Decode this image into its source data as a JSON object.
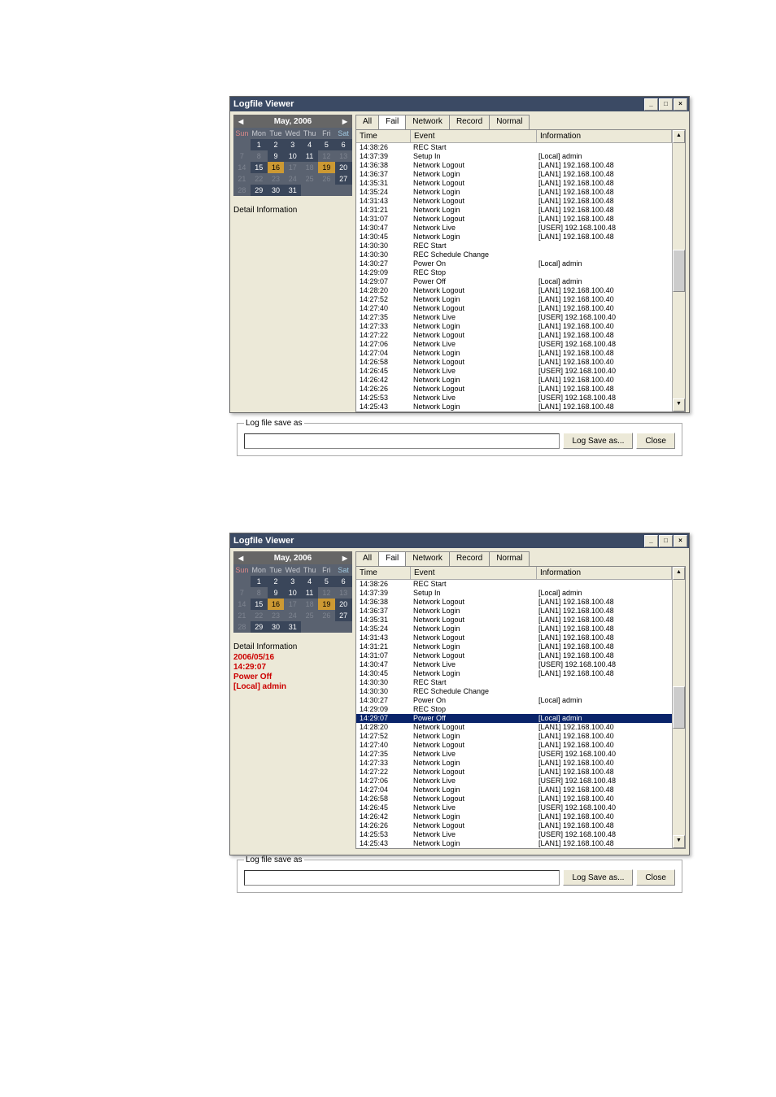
{
  "title": "Logfile Viewer",
  "month_label": "May, 2006",
  "dow": [
    "Sun",
    "Mon",
    "Tue",
    "Wed",
    "Thu",
    "Fri",
    "Sat"
  ],
  "calendar": [
    [
      {
        "v": "",
        "c": ""
      },
      {
        "v": "1",
        "c": "hi0"
      },
      {
        "v": "2",
        "c": "hi0"
      },
      {
        "v": "3",
        "c": "hi0"
      },
      {
        "v": "4",
        "c": "hi0"
      },
      {
        "v": "5",
        "c": "hi0"
      },
      {
        "v": "6",
        "c": "hi0"
      }
    ],
    [
      {
        "v": "7",
        "c": "dim"
      },
      {
        "v": "8",
        "c": "dim"
      },
      {
        "v": "9",
        "c": "hi0"
      },
      {
        "v": "10",
        "c": "hi0"
      },
      {
        "v": "11",
        "c": "hi0"
      },
      {
        "v": "12",
        "c": "dim"
      },
      {
        "v": "13",
        "c": "dim"
      }
    ],
    [
      {
        "v": "14",
        "c": "dim"
      },
      {
        "v": "15",
        "c": "hi0"
      },
      {
        "v": "16",
        "c": "hi1"
      },
      {
        "v": "17",
        "c": "dim"
      },
      {
        "v": "18",
        "c": "dim"
      },
      {
        "v": "19",
        "c": "hi1"
      },
      {
        "v": "20",
        "c": "hi0"
      }
    ],
    [
      {
        "v": "21",
        "c": "dim"
      },
      {
        "v": "22",
        "c": "dim"
      },
      {
        "v": "23",
        "c": "dim"
      },
      {
        "v": "24",
        "c": "dim"
      },
      {
        "v": "25",
        "c": "dim"
      },
      {
        "v": "26",
        "c": "dim"
      },
      {
        "v": "27",
        "c": "hi0"
      }
    ],
    [
      {
        "v": "28",
        "c": "dim"
      },
      {
        "v": "29",
        "c": "hi0"
      },
      {
        "v": "30",
        "c": "hi0"
      },
      {
        "v": "31",
        "c": "hi0"
      },
      {
        "v": "",
        "c": ""
      },
      {
        "v": "",
        "c": ""
      },
      {
        "v": "",
        "c": ""
      }
    ]
  ],
  "detail_label": "Detail Information",
  "detail2": [
    "2006/05/16",
    "14:29:07",
    "Power Off",
    "[Local] admin"
  ],
  "tabs": [
    "All",
    "Fail",
    "Network",
    "Record",
    "Normal"
  ],
  "active_tab": 1,
  "list_headers": {
    "time": "Time",
    "event": "Event",
    "info": "Information"
  },
  "logs": [
    {
      "t": "14:38:26",
      "e": "REC Start",
      "i": ""
    },
    {
      "t": "14:37:39",
      "e": "Setup In",
      "i": "[Local] admin"
    },
    {
      "t": "14:36:38",
      "e": "Network Logout",
      "i": "[LAN1] 192.168.100.48"
    },
    {
      "t": "14:36:37",
      "e": "Network Login",
      "i": "[LAN1] 192.168.100.48"
    },
    {
      "t": "14:35:31",
      "e": "Network Logout",
      "i": "[LAN1] 192.168.100.48"
    },
    {
      "t": "14:35:24",
      "e": "Network Login",
      "i": "[LAN1] 192.168.100.48"
    },
    {
      "t": "14:31:43",
      "e": "Network Logout",
      "i": "[LAN1] 192.168.100.48"
    },
    {
      "t": "14:31:21",
      "e": "Network Login",
      "i": "[LAN1] 192.168.100.48"
    },
    {
      "t": "14:31:07",
      "e": "Network Logout",
      "i": "[LAN1] 192.168.100.48"
    },
    {
      "t": "14:30:47",
      "e": "Network Live",
      "i": "[USER] 192.168.100.48"
    },
    {
      "t": "14:30:45",
      "e": "Network Login",
      "i": "[LAN1] 192.168.100.48"
    },
    {
      "t": "14:30:30",
      "e": "REC Start",
      "i": ""
    },
    {
      "t": "14:30:30",
      "e": "REC Schedule Change",
      "i": ""
    },
    {
      "t": "14:30:27",
      "e": "Power On",
      "i": "[Local] admin"
    },
    {
      "t": "14:29:09",
      "e": "REC Stop",
      "i": ""
    },
    {
      "t": "14:29:07",
      "e": "Power Off",
      "i": "[Local] admin"
    },
    {
      "t": "14:28:20",
      "e": "Network Logout",
      "i": "[LAN1] 192.168.100.40"
    },
    {
      "t": "14:27:52",
      "e": "Network Login",
      "i": "[LAN1] 192.168.100.40"
    },
    {
      "t": "14:27:40",
      "e": "Network Logout",
      "i": "[LAN1] 192.168.100.40"
    },
    {
      "t": "14:27:35",
      "e": "Network Live",
      "i": "[USER] 192.168.100.40"
    },
    {
      "t": "14:27:33",
      "e": "Network Login",
      "i": "[LAN1] 192.168.100.40"
    },
    {
      "t": "14:27:22",
      "e": "Network Logout",
      "i": "[LAN1] 192.168.100.48"
    },
    {
      "t": "14:27:06",
      "e": "Network Live",
      "i": "[USER] 192.168.100.48"
    },
    {
      "t": "14:27:04",
      "e": "Network Login",
      "i": "[LAN1] 192.168.100.48"
    },
    {
      "t": "14:26:58",
      "e": "Network Logout",
      "i": "[LAN1] 192.168.100.40"
    },
    {
      "t": "14:26:45",
      "e": "Network Live",
      "i": "[USER] 192.168.100.40"
    },
    {
      "t": "14:26:42",
      "e": "Network Login",
      "i": "[LAN1] 192.168.100.40"
    },
    {
      "t": "14:26:26",
      "e": "Network Logout",
      "i": "[LAN1] 192.168.100.48"
    },
    {
      "t": "14:25:53",
      "e": "Network Live",
      "i": "[USER] 192.168.100.48"
    },
    {
      "t": "14:25:43",
      "e": "Network Login",
      "i": "[LAN1] 192.168.100.48"
    }
  ],
  "logs2": [
    {
      "t": "14:38:26",
      "e": "REC Start",
      "i": ""
    },
    {
      "t": "14:37:39",
      "e": "Setup In",
      "i": "[Local] admin"
    },
    {
      "t": "14:36:38",
      "e": "Network Logout",
      "i": "[LAN1] 192.168.100.48"
    },
    {
      "t": "14:36:37",
      "e": "Network Login",
      "i": "[LAN1] 192.168.100.48"
    },
    {
      "t": "14:35:31",
      "e": "Network Logout",
      "i": "[LAN1] 192.168.100.48"
    },
    {
      "t": "14:35:24",
      "e": "Network Login",
      "i": "[LAN1] 192.168.100.48"
    },
    {
      "t": "14:31:43",
      "e": "Network Logout",
      "i": "[LAN1] 192.168.100.48"
    },
    {
      "t": "14:31:21",
      "e": "Network Login",
      "i": "[LAN1] 192.168.100.48"
    },
    {
      "t": "14:31:07",
      "e": "Network Logout",
      "i": "[LAN1] 192.168.100.48"
    },
    {
      "t": "14:30:47",
      "e": "Network Live",
      "i": "[USER] 192.168.100.48"
    },
    {
      "t": "14:30:45",
      "e": "Network Login",
      "i": "[LAN1] 192.168.100.48"
    },
    {
      "t": "14:30:30",
      "e": "REC Start",
      "i": ""
    },
    {
      "t": "14:30:30",
      "e": "REC Schedule Change",
      "i": ""
    },
    {
      "t": "14:30:27",
      "e": "Power On",
      "i": "[Local] admin"
    },
    {
      "t": "14:29:09",
      "e": "REC Stop",
      "i": ""
    },
    {
      "t": "14:29:07",
      "e": "Power Off",
      "i": "[Local] admin",
      "sel": true
    },
    {
      "t": "14:28:20",
      "e": "Network Logout",
      "i": "[LAN1] 192.168.100.40"
    },
    {
      "t": "14:27:52",
      "e": "Network Login",
      "i": "[LAN1] 192.168.100.40"
    },
    {
      "t": "14:27:40",
      "e": "Network Logout",
      "i": "[LAN1] 192.168.100.40"
    },
    {
      "t": "14:27:35",
      "e": "Network Live",
      "i": "[USER] 192.168.100.40"
    },
    {
      "t": "14:27:33",
      "e": "Network Login",
      "i": "[LAN1] 192.168.100.40"
    },
    {
      "t": "14:27:22",
      "e": "Network Logout",
      "i": "[LAN1] 192.168.100.48"
    },
    {
      "t": "14:27:06",
      "e": "Network Live",
      "i": "[USER] 192.168.100.48"
    },
    {
      "t": "14:27:04",
      "e": "Network Login",
      "i": "[LAN1] 192.168.100.48"
    },
    {
      "t": "14:26:58",
      "e": "Network Logout",
      "i": "[LAN1] 192.168.100.40"
    },
    {
      "t": "14:26:45",
      "e": "Network Live",
      "i": "[USER] 192.168.100.40"
    },
    {
      "t": "14:26:42",
      "e": "Network Login",
      "i": "[LAN1] 192.168.100.40"
    },
    {
      "t": "14:26:26",
      "e": "Network Logout",
      "i": "[LAN1] 192.168.100.48"
    },
    {
      "t": "14:25:53",
      "e": "Network Live",
      "i": "[USER] 192.168.100.48"
    },
    {
      "t": "14:25:43",
      "e": "Network Login",
      "i": "[LAN1] 192.168.100.48"
    }
  ],
  "footer": {
    "legend": "Log file save as",
    "saveas": "Log Save as...",
    "close": "Close"
  }
}
